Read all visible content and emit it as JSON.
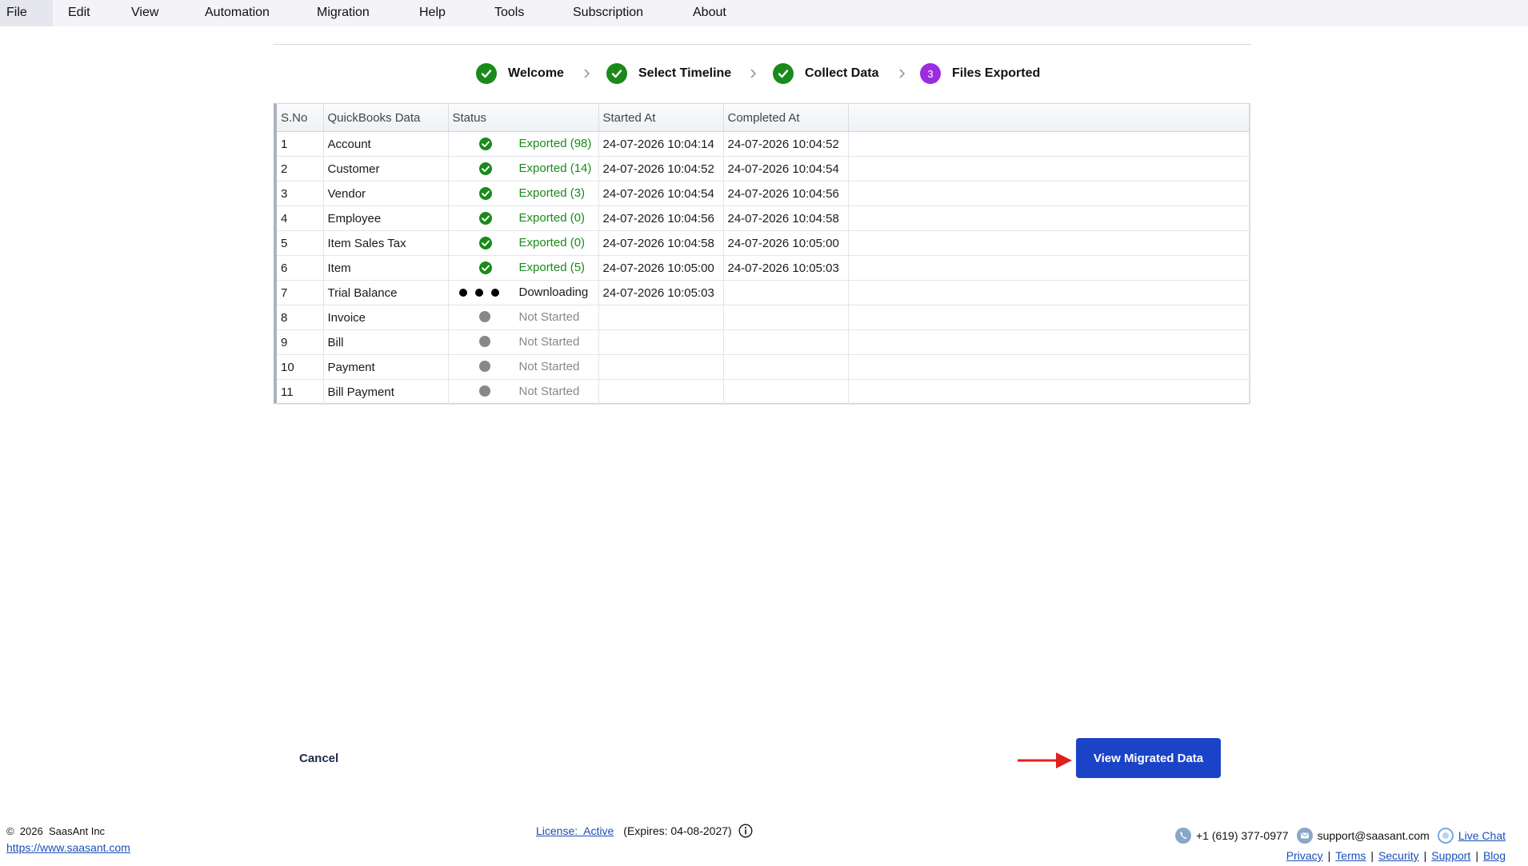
{
  "menu": [
    "File",
    "Edit",
    "View",
    "Automation",
    "Migration",
    "Help",
    "Tools",
    "Subscription",
    "About"
  ],
  "steps": [
    {
      "label": "Welcome",
      "state": "done"
    },
    {
      "label": "Select Timeline",
      "state": "done"
    },
    {
      "label": "Collect Data",
      "state": "done"
    },
    {
      "label": "Files Exported",
      "state": "current",
      "number": "3"
    }
  ],
  "table": {
    "headers": [
      "S.No",
      "QuickBooks Data",
      "Status",
      "Started At",
      "Completed At"
    ],
    "rows": [
      {
        "sno": "1",
        "name": "Account",
        "status": "Exported (98)",
        "state": "exported",
        "started": "24-07-2026 10:04:14",
        "completed": "24-07-2026 10:04:52"
      },
      {
        "sno": "2",
        "name": "Customer",
        "status": "Exported (14)",
        "state": "exported",
        "started": "24-07-2026 10:04:52",
        "completed": "24-07-2026 10:04:54"
      },
      {
        "sno": "3",
        "name": "Vendor",
        "status": "Exported (3)",
        "state": "exported",
        "started": "24-07-2026 10:04:54",
        "completed": "24-07-2026 10:04:56"
      },
      {
        "sno": "4",
        "name": "Employee",
        "status": "Exported (0)",
        "state": "exported",
        "started": "24-07-2026 10:04:56",
        "completed": "24-07-2026 10:04:58"
      },
      {
        "sno": "5",
        "name": "Item Sales Tax",
        "status": "Exported (0)",
        "state": "exported",
        "started": "24-07-2026 10:04:58",
        "completed": "24-07-2026 10:05:00"
      },
      {
        "sno": "6",
        "name": "Item",
        "status": "Exported (5)",
        "state": "exported",
        "started": "24-07-2026 10:05:00",
        "completed": "24-07-2026 10:05:03"
      },
      {
        "sno": "7",
        "name": "Trial Balance",
        "status": "Downloading",
        "state": "downloading",
        "started": "24-07-2026 10:05:03",
        "completed": ""
      },
      {
        "sno": "8",
        "name": "Invoice",
        "status": "Not Started",
        "state": "notstarted",
        "started": "",
        "completed": ""
      },
      {
        "sno": "9",
        "name": "Bill",
        "status": "Not Started",
        "state": "notstarted",
        "started": "",
        "completed": ""
      },
      {
        "sno": "10",
        "name": "Payment",
        "status": "Not Started",
        "state": "notstarted",
        "started": "",
        "completed": ""
      },
      {
        "sno": "11",
        "name": "Bill Payment",
        "status": "Not Started",
        "state": "notstarted",
        "started": "",
        "completed": ""
      }
    ]
  },
  "actions": {
    "cancel": "Cancel",
    "view_migrated": "View Migrated Data"
  },
  "footer": {
    "copyright": "©  2026  SaasAnt Inc",
    "website": "https://www.saasant.com",
    "license": "License:  Active",
    "expires": "(Expires: 04-08-2027)",
    "phone": "+1 (619) 377-0977",
    "email": "support@saasant.com",
    "livechat": "Live Chat",
    "links": [
      "Privacy",
      "Terms",
      "Security",
      "Support",
      "Blog"
    ]
  },
  "colors": {
    "primary": "#1a43c8",
    "success": "#1a8a1a",
    "current_step": "#9b2ce0",
    "arrow": "#e02020"
  },
  "icons": {
    "done": "check-circle-icon",
    "pending": "grey-dot-icon",
    "downloading": "loading-dots-icon"
  }
}
